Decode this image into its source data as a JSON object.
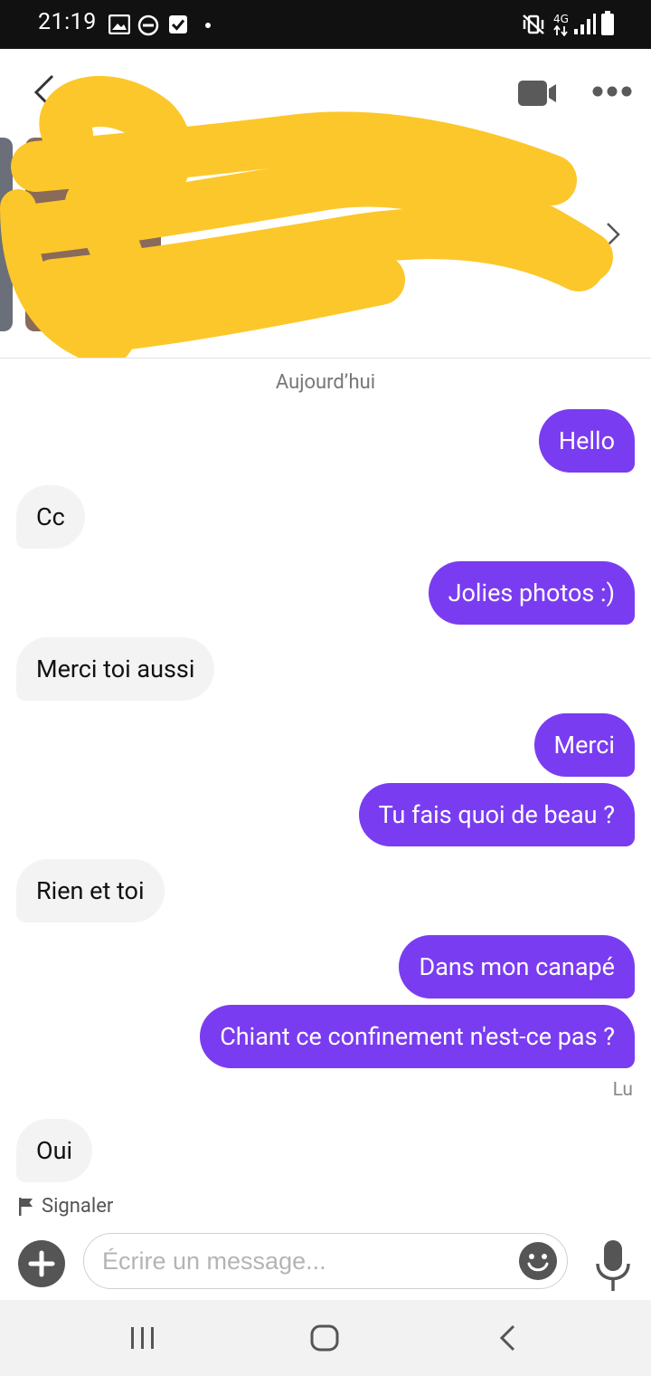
{
  "status_bar": {
    "time": "21:19",
    "network": "4G"
  },
  "header": {
    "back_icon": "chevron-left-icon",
    "video_icon": "video-camera-icon",
    "more_icon": "more-horizontal-icon",
    "next_icon": "chevron-right-icon"
  },
  "conversation": {
    "date_label": "Aujourd’hui",
    "read_receipt": "Lu",
    "report_label": "Signaler",
    "messages": [
      {
        "from": "me",
        "text": "Hello"
      },
      {
        "from": "them",
        "text": "Cc"
      },
      {
        "from": "me",
        "text": "Jolies photos :)"
      },
      {
        "from": "them",
        "text": "Merci toi aussi"
      },
      {
        "from": "me",
        "text": "Merci"
      },
      {
        "from": "me",
        "text": "Tu fais quoi de beau ?"
      },
      {
        "from": "them",
        "text": "Rien et toi"
      },
      {
        "from": "me",
        "text": "Dans mon canapé"
      },
      {
        "from": "me",
        "text": "Chiant ce confinement n'est-ce pas ?"
      },
      {
        "from": "them",
        "text": "Oui"
      }
    ]
  },
  "composer": {
    "placeholder": "Écrire un message...",
    "add_icon": "plus-icon",
    "emoji_icon": "emoji-icon",
    "mic_icon": "microphone-icon"
  },
  "colors": {
    "outgoing_bubble": "#7a3cf0",
    "incoming_bubble": "#f3f3f3",
    "redaction": "#fcc72a"
  }
}
